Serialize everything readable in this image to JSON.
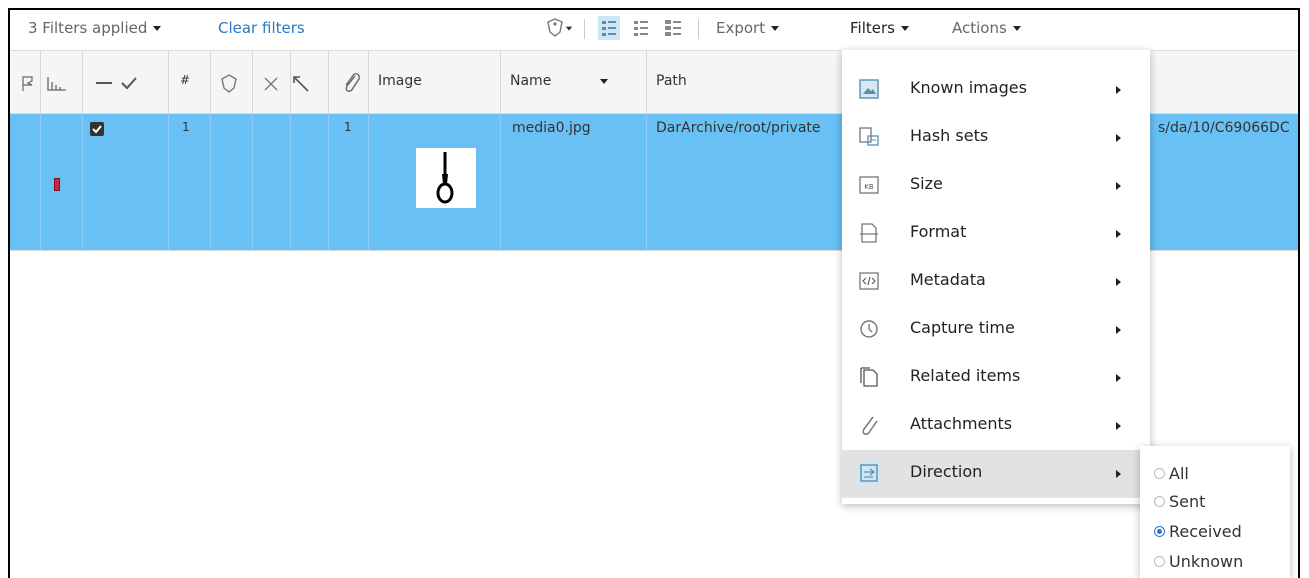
{
  "toolbar": {
    "filters_applied": "3 Filters applied",
    "clear_filters": "Clear filters",
    "export_label": "Export",
    "filters_label": "Filters",
    "actions_label": "Actions"
  },
  "table": {
    "columns": {
      "number": "#",
      "image": "Image",
      "name": "Name",
      "path": "Path"
    },
    "rows": [
      {
        "number": "1",
        "attachments": "1",
        "name": "media0.jpg",
        "path_left": "DarArchive/root/private",
        "path_right": "s/da/10/C69066DC",
        "checked": true,
        "tag_color": "#d0263a"
      }
    ],
    "selected_row_color": "#69c0f5"
  },
  "filters_menu": {
    "items": [
      {
        "label": "Known images",
        "icon": "known-images-icon"
      },
      {
        "label": "Hash sets",
        "icon": "hash-sets-icon"
      },
      {
        "label": "Size",
        "icon": "size-icon"
      },
      {
        "label": "Format",
        "icon": "format-icon"
      },
      {
        "label": "Metadata",
        "icon": "metadata-icon"
      },
      {
        "label": "Capture time",
        "icon": "clock-icon"
      },
      {
        "label": "Related items",
        "icon": "related-items-icon"
      },
      {
        "label": "Attachments",
        "icon": "paperclip-icon"
      },
      {
        "label": "Direction",
        "icon": "direction-icon",
        "highlighted": true
      }
    ]
  },
  "direction_submenu": {
    "options": [
      {
        "label": "All",
        "selected": false
      },
      {
        "label": "Sent",
        "selected": false
      },
      {
        "label": "Received",
        "selected": true
      },
      {
        "label": "Unknown",
        "selected": false
      }
    ]
  },
  "colors": {
    "accent": "#2a78c6",
    "menu_icon": "#5a8fb0"
  }
}
